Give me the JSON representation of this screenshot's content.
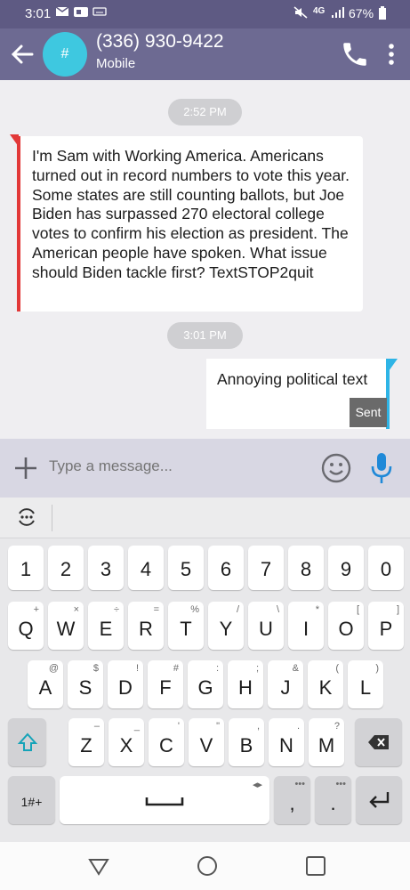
{
  "status": {
    "time": "3:01",
    "battery": "67%",
    "network": "4G"
  },
  "header": {
    "avatar_glyph": "#",
    "title": "(336) 930-9422",
    "subtitle": "Mobile"
  },
  "chat": {
    "timestamp1": "2:52 PM",
    "incoming": "I'm Sam with Working America. Americans turned out in record numbers to vote this year. Some states are still counting ballots, but Joe Biden has surpassed 270 electoral college votes to confirm his election as president. The American people have spoken. What issue should Biden tackle first? TextSTOP2quit",
    "timestamp2": "3:01 PM",
    "outgoing": "Annoying political text",
    "sent_label": "Sent"
  },
  "composer": {
    "placeholder": "Type a message..."
  },
  "keyboard": {
    "numbers": [
      "1",
      "2",
      "3",
      "4",
      "5",
      "6",
      "7",
      "8",
      "9",
      "0"
    ],
    "row1": [
      [
        "Q",
        "+"
      ],
      [
        "W",
        "×"
      ],
      [
        "E",
        "÷"
      ],
      [
        "R",
        "="
      ],
      [
        "T",
        "%"
      ],
      [
        "Y",
        "/"
      ],
      [
        "U",
        "\\"
      ],
      [
        "I",
        "*"
      ],
      [
        "O",
        "["
      ],
      [
        "P",
        "]"
      ]
    ],
    "row2": [
      [
        "A",
        "@"
      ],
      [
        "S",
        "$"
      ],
      [
        "D",
        "!"
      ],
      [
        "F",
        "#"
      ],
      [
        "G",
        ":"
      ],
      [
        "H",
        ";"
      ],
      [
        "J",
        "&"
      ],
      [
        "K",
        "("
      ],
      [
        "L",
        ")"
      ]
    ],
    "row3": [
      [
        "Z",
        "–"
      ],
      [
        "X",
        "_"
      ],
      [
        "C",
        "'"
      ],
      [
        "V",
        "\""
      ],
      [
        "B",
        ","
      ],
      [
        "N",
        "."
      ],
      [
        "M",
        "?"
      ]
    ],
    "symbols_key": "1#+",
    "comma": ",",
    "period": "."
  },
  "colors": {
    "header": "#6d6a92",
    "status": "#5e5a83",
    "accent": "#2eb4e6",
    "incoming_bar": "#e23838",
    "avatar": "#3ec8e0"
  },
  "icons": [
    "back-arrow-icon",
    "phone-icon",
    "more-vert-icon",
    "plus-icon",
    "emoji-icon",
    "mic-icon",
    "keyboard-settings-icon",
    "shift-icon",
    "backspace-icon",
    "enter-icon",
    "nav-back-icon",
    "nav-home-icon",
    "nav-recents-icon"
  ]
}
